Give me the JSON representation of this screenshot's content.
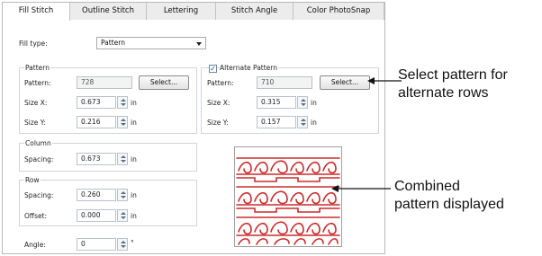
{
  "tabs": [
    "Fill Stitch",
    "Outline Stitch",
    "Lettering",
    "Stitch Angle",
    "Color PhotoSnap"
  ],
  "fill_type": {
    "label": "Fill type:",
    "value": "Pattern"
  },
  "pattern": {
    "header": "Pattern",
    "pattern_label": "Pattern:",
    "pattern_value": "728",
    "select_label": "Select...",
    "size_x_label": "Size X:",
    "size_x_value": "0.673",
    "size_y_label": "Size Y:",
    "size_y_value": "0.216",
    "unit": "in"
  },
  "alternate": {
    "checked": "✓",
    "header": "Alternate Pattern",
    "pattern_label": "Pattern:",
    "pattern_value": "710",
    "select_label": "Select...",
    "size_x_label": "Size X:",
    "size_x_value": "0.315",
    "size_y_label": "Size Y:",
    "size_y_value": "0.157",
    "unit": "in"
  },
  "column": {
    "header": "Column",
    "spacing_label": "Spacing:",
    "spacing_value": "0.673",
    "unit": "in"
  },
  "row": {
    "header": "Row",
    "spacing_label": "Spacing:",
    "spacing_value": "0.260",
    "offset_label": "Offset:",
    "offset_value": "0.000",
    "unit": "in"
  },
  "angle": {
    "label": "Angle:",
    "value": "0",
    "unit": "°"
  },
  "annotations": {
    "select_pattern": [
      "Select pattern for",
      "alternate rows"
    ],
    "combined": [
      "Combined",
      "pattern displayed"
    ]
  },
  "colors": {
    "pattern_red": "#cc2b2b",
    "group_border": "#d0d5da"
  }
}
